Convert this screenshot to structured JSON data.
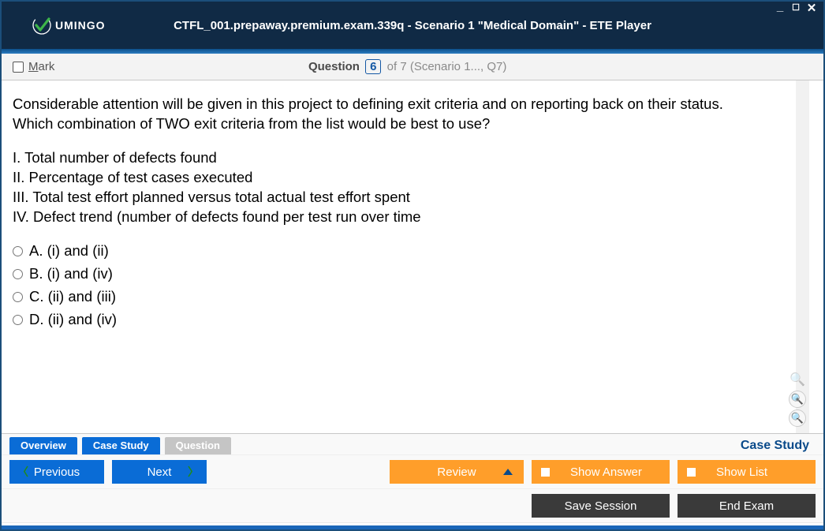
{
  "window": {
    "logo_text": "UMINGO",
    "title": "CTFL_001.prepaway.premium.exam.339q - Scenario 1 \"Medical Domain\" - ETE Player"
  },
  "qheader": {
    "mark_label_pre": "M",
    "mark_label_rest": "ark",
    "question_word": "Question",
    "current_number": "6",
    "total_text": "of 7 (Scenario 1..., Q7)"
  },
  "content": {
    "prompt_line1": "Considerable attention will be given in this project to defining exit criteria and on reporting back on their status.",
    "prompt_line2": "Which combination of TWO exit criteria from the list would be best to use?",
    "roman": [
      "I. Total number of defects found",
      "II. Percentage of test cases executed",
      "III. Total test effort planned versus total actual test effort spent",
      "IV. Defect trend (number of defects found per test run over time"
    ],
    "choices": [
      {
        "letter": "A.",
        "text": "(i) and (ii)"
      },
      {
        "letter": "B.",
        "text": "(i) and (iv)"
      },
      {
        "letter": "C.",
        "text": "(ii) and (iii)"
      },
      {
        "letter": "D.",
        "text": "(ii) and (iv)"
      }
    ]
  },
  "tabs": {
    "overview": "Overview",
    "case_study": "Case Study",
    "question": "Question",
    "case_study_label": "Case Study"
  },
  "buttons": {
    "previous": "Previous",
    "next": "Next",
    "review": "Review",
    "show_answer": "Show Answer",
    "show_list": "Show List",
    "save_session": "Save Session",
    "end_exam": "End Exam"
  }
}
